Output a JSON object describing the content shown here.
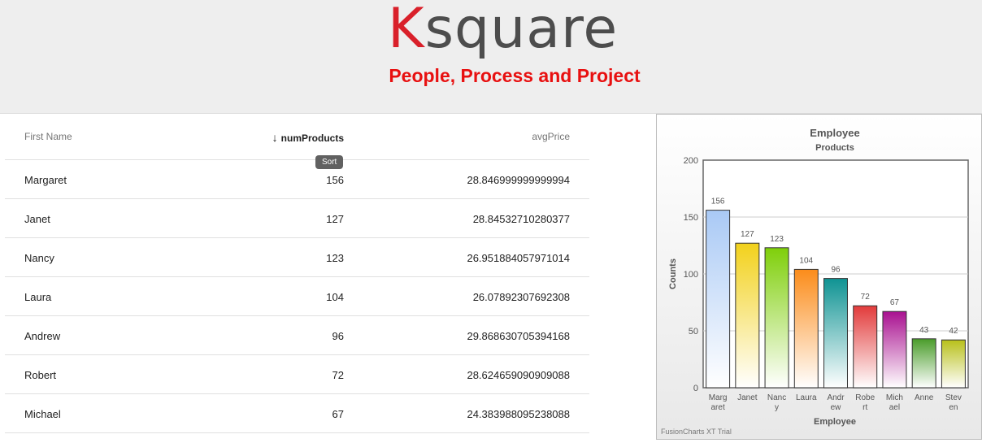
{
  "header": {
    "logo_first": "K",
    "logo_rest": "square",
    "tagline": "People, Process and Project",
    "tagline_color": "#e81010"
  },
  "table": {
    "columns": [
      "First Name",
      "numProducts",
      "avgPrice"
    ],
    "sort_arrow": "↓",
    "sort_tooltip": "Sort",
    "rows": [
      {
        "name": "Margaret",
        "num": "156",
        "avg": "28.846999999999994"
      },
      {
        "name": "Janet",
        "num": "127",
        "avg": "28.84532710280377"
      },
      {
        "name": "Nancy",
        "num": "123",
        "avg": "26.951884057971014"
      },
      {
        "name": "Laura",
        "num": "104",
        "avg": "26.07892307692308"
      },
      {
        "name": "Andrew",
        "num": "96",
        "avg": "29.868630705394168"
      },
      {
        "name": "Robert",
        "num": "72",
        "avg": "28.624659090909088"
      },
      {
        "name": "Michael",
        "num": "67",
        "avg": "24.383988095238088"
      }
    ]
  },
  "chart_data": {
    "type": "bar",
    "title": "Employee",
    "subtitle": "Products",
    "xlabel": "Employee",
    "ylabel": "Counts",
    "categories": [
      "Margaret",
      "Janet",
      "Nancy",
      "Laura",
      "Andrew",
      "Robert",
      "Michael",
      "Anne",
      "Steven"
    ],
    "tick_labels": [
      [
        "Marg",
        "aret"
      ],
      [
        "Janet"
      ],
      [
        "Nanc",
        "y"
      ],
      [
        "Laura"
      ],
      [
        "Andr",
        "ew"
      ],
      [
        "Robe",
        "rt"
      ],
      [
        "Mich",
        "ael"
      ],
      [
        "Anne"
      ],
      [
        "Stev",
        "en"
      ]
    ],
    "values": [
      156,
      127,
      123,
      104,
      96,
      72,
      67,
      43,
      42
    ],
    "ylim": [
      0,
      200
    ],
    "yticks": [
      0,
      50,
      100,
      150,
      200
    ],
    "colors": [
      "#a9c9f5",
      "#f2d11b",
      "#7fcf0a",
      "#fb8c1a",
      "#0f9393",
      "#e23b3b",
      "#a91190",
      "#4a9c2a",
      "#b8c01a"
    ],
    "grid": true,
    "watermark": "FusionCharts XT Trial"
  }
}
